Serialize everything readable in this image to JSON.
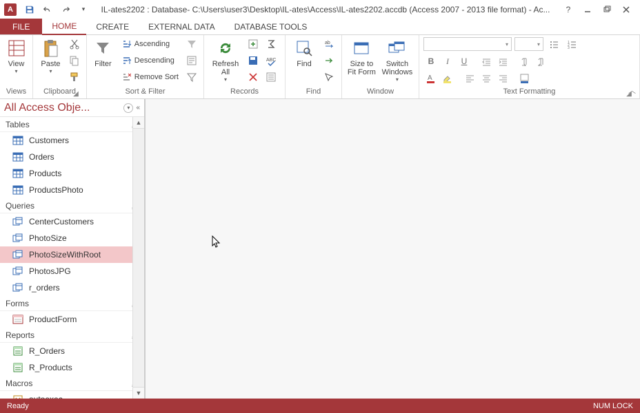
{
  "title": "IL-ates2202 : Database- C:\\Users\\user3\\Desktop\\IL-ates\\Access\\IL-ates2202.accdb (Access 2007 - 2013 file format) - Ac...",
  "tabs": {
    "file": "FILE",
    "home": "HOME",
    "create": "CREATE",
    "external": "EXTERNAL DATA",
    "dbtools": "DATABASE TOOLS"
  },
  "ribbon": {
    "views": {
      "label": "Views",
      "view": "View"
    },
    "clipboard": {
      "label": "Clipboard",
      "paste": "Paste"
    },
    "sortfilter": {
      "label": "Sort & Filter",
      "filter": "Filter",
      "asc": "Ascending",
      "desc": "Descending",
      "remove": "Remove Sort"
    },
    "records": {
      "label": "Records",
      "refresh": "Refresh All"
    },
    "find": {
      "label": "Find",
      "find": "Find"
    },
    "window": {
      "label": "Window",
      "size": "Size to Fit Form",
      "switch": "Switch Windows"
    },
    "text": {
      "label": "Text Formatting"
    }
  },
  "nav": {
    "title": "All Access Obje...",
    "groups": [
      {
        "name": "Tables",
        "type": "table",
        "items": [
          "Customers",
          "Orders",
          "Products",
          "ProductsPhoto"
        ]
      },
      {
        "name": "Queries",
        "type": "query",
        "items": [
          "CenterCustomers",
          "PhotoSize",
          "PhotoSizeWithRoot",
          "PhotosJPG",
          "r_orders"
        ]
      },
      {
        "name": "Forms",
        "type": "form",
        "items": [
          "ProductForm"
        ]
      },
      {
        "name": "Reports",
        "type": "report",
        "items": [
          "R_Orders",
          "R_Products"
        ]
      },
      {
        "name": "Macros",
        "type": "macro",
        "items": [
          "autoexec"
        ]
      }
    ],
    "selected": "PhotoSizeWithRoot"
  },
  "status": {
    "ready": "Ready",
    "numlock": "NUM LOCK"
  }
}
